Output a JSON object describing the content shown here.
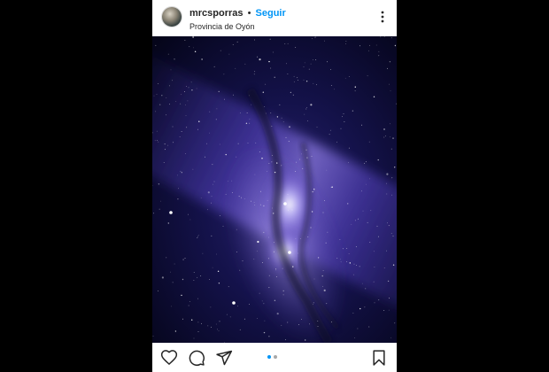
{
  "post": {
    "username": "mrcsporras",
    "separator": "•",
    "follow_label": "Seguir",
    "location": "Provincia de Oyón",
    "menu_icon": "more-vertical-icon",
    "image_subject": "milky-way-night-sky"
  },
  "actions": {
    "icons": [
      "heart-icon",
      "comment-icon",
      "share-icon",
      "bookmark-icon"
    ]
  },
  "carousel": {
    "total": 2,
    "active_index": 0
  },
  "colors": {
    "follow": "#0095f6",
    "text": "#262626",
    "dot_active": "#0095f6",
    "dot_inactive": "#a8a8a8",
    "backdrop": "#000000"
  }
}
